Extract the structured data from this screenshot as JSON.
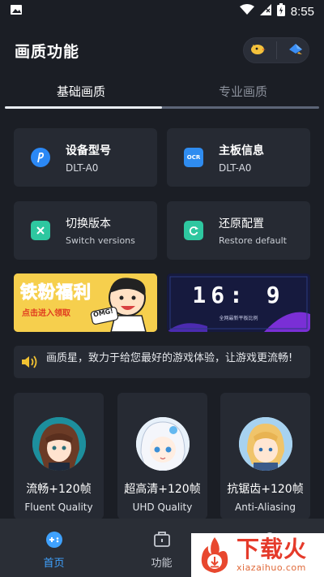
{
  "status_bar": {
    "time": "8:55"
  },
  "header": {
    "title": "画质功能"
  },
  "tabs": [
    {
      "label": "基础画质"
    },
    {
      "label": "专业画质"
    }
  ],
  "cards": {
    "device": {
      "title": "设备型号",
      "value": "DLT-A0"
    },
    "board": {
      "title": "主板信息",
      "value": "DLT-A0",
      "icon_text": "OCR"
    },
    "switch": {
      "title": "切换版本",
      "subtitle": "Switch versions"
    },
    "restore": {
      "title": "还原配置",
      "subtitle": "Restore default"
    }
  },
  "banners": {
    "left": {
      "title": "铁粉福利",
      "sub": "点击进入领取",
      "bubble": "OMG!"
    },
    "right": {
      "ratio": "16: 9",
      "caption": "全网最新平板比例"
    }
  },
  "notice": {
    "text": "画质星，致力于给您最好的游戏体验，让游戏更流畅!"
  },
  "modes": [
    {
      "name": "流畅+120帧",
      "sub": "Fluent Quality"
    },
    {
      "name": "超高清+120帧",
      "sub": "UHD Quality"
    },
    {
      "name": "抗锯齿+120帧",
      "sub": "Anti-Aliasing"
    }
  ],
  "bottom_nav": [
    {
      "label": "首页"
    },
    {
      "label": "功能"
    }
  ],
  "watermark": {
    "text": "下载火",
    "url": "xiazaihuo.com"
  },
  "colors": {
    "accent": "#3fa2ff",
    "background": "#1b1e25",
    "card": "#262a33"
  }
}
